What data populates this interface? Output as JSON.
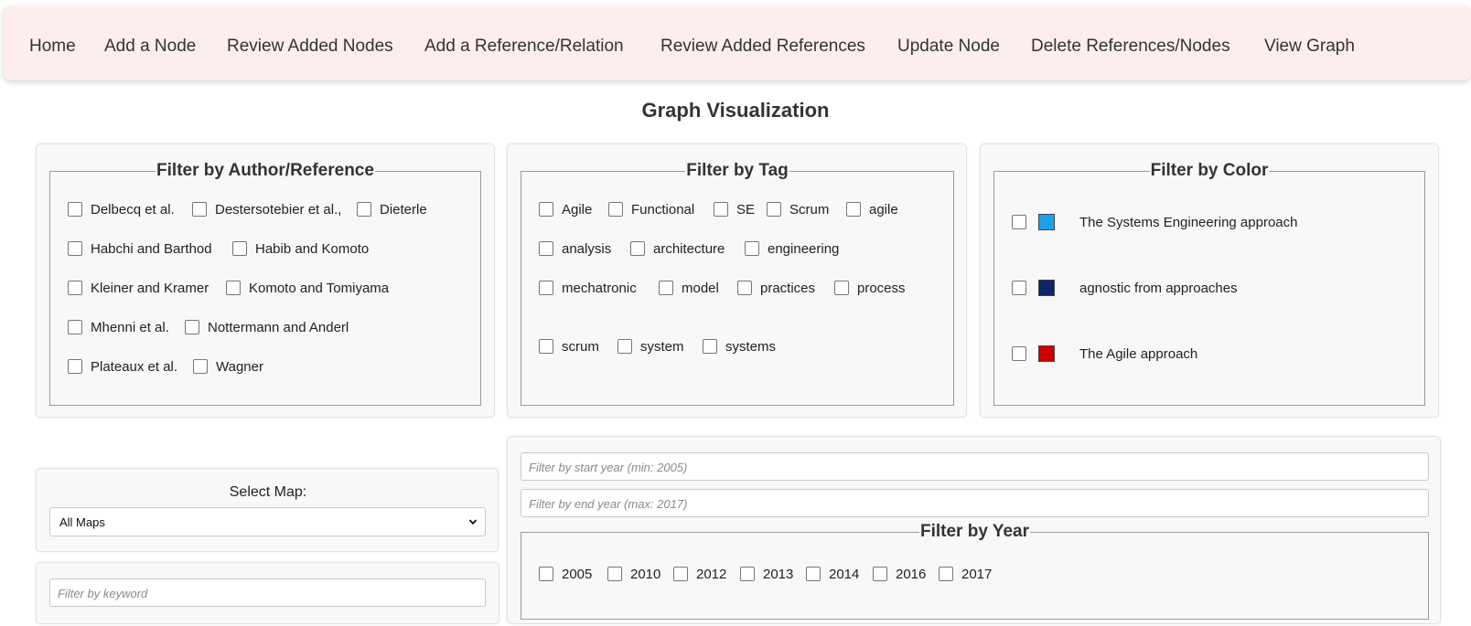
{
  "nav": {
    "items": [
      {
        "label": "Home"
      },
      {
        "label": "Add a Node"
      },
      {
        "label": "Review Added Nodes"
      },
      {
        "label": "Add a Reference/Relation"
      },
      {
        "label": "Review Added References"
      },
      {
        "label": "Update Node"
      },
      {
        "label": "Delete References/Nodes"
      },
      {
        "label": "View Graph"
      }
    ]
  },
  "page": {
    "title": "Graph Visualization"
  },
  "filters": {
    "author": {
      "legend": "Filter by Author/Reference",
      "items": [
        "Delbecq et al.",
        "Destersotebier et al.,",
        "Dieterle",
        "Habchi and Barthod",
        "Habib and Komoto",
        "Kleiner and Kramer",
        "Komoto and Tomiyama",
        "Mhenni et al.",
        "Nottermann and Anderl",
        "Plateaux et al.",
        "Wagner"
      ]
    },
    "tag": {
      "legend": "Filter by Tag",
      "items": [
        "Agile",
        "Functional",
        "SE",
        "Scrum",
        "agile",
        "analysis",
        "architecture",
        "engineering",
        "mechatronic",
        "model",
        "practices",
        "process",
        "scrum",
        "system",
        "systems"
      ]
    },
    "color": {
      "legend": "Filter by Color",
      "items": [
        {
          "label": "The Systems Engineering approach",
          "color": "#1aa3e8"
        },
        {
          "label": "agnostic from approaches",
          "color": "#0d2466"
        },
        {
          "label": "The Agile approach",
          "color": "#cc0000"
        }
      ]
    },
    "map": {
      "label": "Select Map:",
      "selected": "All Maps"
    },
    "keyword": {
      "placeholder": "Filter by keyword"
    },
    "year": {
      "start_placeholder": "Filter by start year (min: 2005)",
      "end_placeholder": "Filter by end year (max: 2017)",
      "legend": "Filter by Year",
      "items": [
        "2005",
        "2010",
        "2012",
        "2013",
        "2014",
        "2016",
        "2017"
      ]
    }
  }
}
